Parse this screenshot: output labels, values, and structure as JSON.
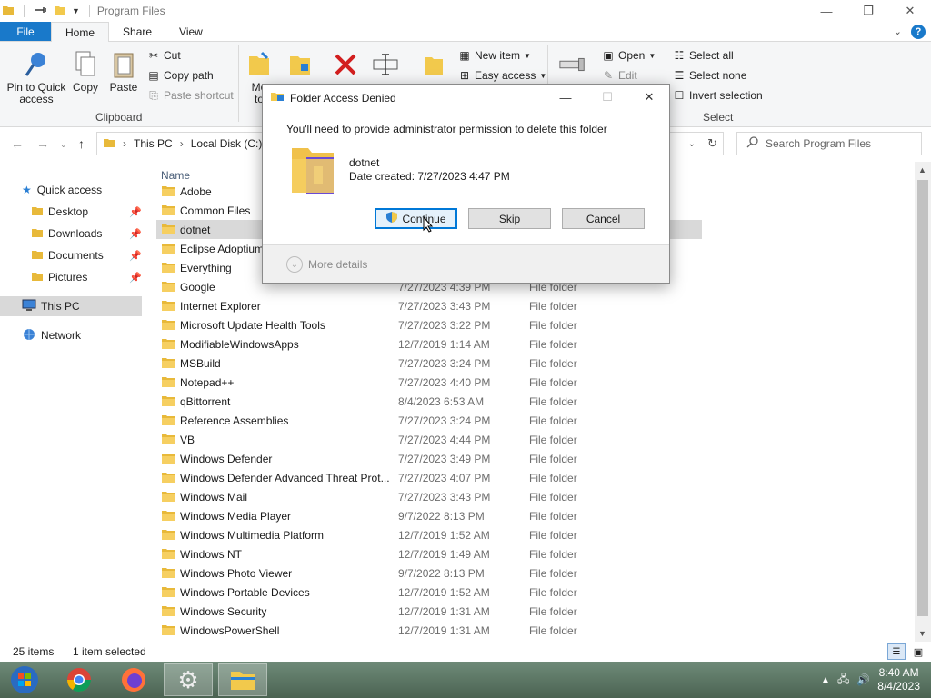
{
  "window": {
    "title": "Program Files",
    "minimize": "—",
    "restore": "❐",
    "close": "✕"
  },
  "tabs": [
    {
      "label": "File"
    },
    {
      "label": "Home"
    },
    {
      "label": "Share"
    },
    {
      "label": "View"
    }
  ],
  "ribbon": {
    "pin_label": "Pin to Quick access",
    "copy_label": "Copy",
    "paste_label": "Paste",
    "cut_label": "Cut",
    "copy_path_label": "Copy path",
    "paste_shortcut_label": "Paste shortcut",
    "clipboard_group": "Clipboard",
    "move_to_label": "Mo to",
    "new_item_label": "New item",
    "easy_access_label": "Easy access",
    "open_label": "Open",
    "edit_label": "Edit",
    "select_all_label": "Select all",
    "select_none_label": "Select none",
    "invert_selection_label": "Invert selection",
    "select_group": "Select"
  },
  "address": {
    "crumbs": [
      "This PC",
      "Local Disk (C:)"
    ],
    "search_placeholder": "Search Program Files"
  },
  "sidebar": {
    "items": [
      {
        "label": "Quick access"
      },
      {
        "label": "Desktop"
      },
      {
        "label": "Downloads"
      },
      {
        "label": "Documents"
      },
      {
        "label": "Pictures"
      },
      {
        "label": "This PC"
      },
      {
        "label": "Network"
      }
    ]
  },
  "filelist": {
    "header_name": "Name",
    "rows": [
      {
        "name": "Adobe",
        "date": "",
        "type": ""
      },
      {
        "name": "Common Files",
        "date": "",
        "type": ""
      },
      {
        "name": "dotnet",
        "date": "",
        "type": ""
      },
      {
        "name": "Eclipse Adoptium",
        "date": "",
        "type": ""
      },
      {
        "name": "Everything",
        "date": "",
        "type": ""
      },
      {
        "name": "Google",
        "date": "7/27/2023 4:39 PM",
        "type": "File folder"
      },
      {
        "name": "Internet Explorer",
        "date": "7/27/2023 3:43 PM",
        "type": "File folder"
      },
      {
        "name": "Microsoft Update Health Tools",
        "date": "7/27/2023 3:22 PM",
        "type": "File folder"
      },
      {
        "name": "ModifiableWindowsApps",
        "date": "12/7/2019 1:14 AM",
        "type": "File folder"
      },
      {
        "name": "MSBuild",
        "date": "7/27/2023 3:24 PM",
        "type": "File folder"
      },
      {
        "name": "Notepad++",
        "date": "7/27/2023 4:40 PM",
        "type": "File folder"
      },
      {
        "name": "qBittorrent",
        "date": "8/4/2023 6:53 AM",
        "type": "File folder"
      },
      {
        "name": "Reference Assemblies",
        "date": "7/27/2023 3:24 PM",
        "type": "File folder"
      },
      {
        "name": "VB",
        "date": "7/27/2023 4:44 PM",
        "type": "File folder"
      },
      {
        "name": "Windows Defender",
        "date": "7/27/2023 3:49 PM",
        "type": "File folder"
      },
      {
        "name": "Windows Defender Advanced Threat Prot...",
        "date": "7/27/2023 4:07 PM",
        "type": "File folder"
      },
      {
        "name": "Windows Mail",
        "date": "7/27/2023 3:43 PM",
        "type": "File folder"
      },
      {
        "name": "Windows Media Player",
        "date": "9/7/2022 8:13 PM",
        "type": "File folder"
      },
      {
        "name": "Windows Multimedia Platform",
        "date": "12/7/2019 1:52 AM",
        "type": "File folder"
      },
      {
        "name": "Windows NT",
        "date": "12/7/2019 1:49 AM",
        "type": "File folder"
      },
      {
        "name": "Windows Photo Viewer",
        "date": "9/7/2022 8:13 PM",
        "type": "File folder"
      },
      {
        "name": "Windows Portable Devices",
        "date": "12/7/2019 1:52 AM",
        "type": "File folder"
      },
      {
        "name": "Windows Security",
        "date": "12/7/2019 1:31 AM",
        "type": "File folder"
      },
      {
        "name": "WindowsPowerShell",
        "date": "12/7/2019 1:31 AM",
        "type": "File folder"
      }
    ]
  },
  "status": {
    "count": "25 items",
    "selected": "1 item selected"
  },
  "taskbar": {
    "time": "8:40 AM",
    "date": "8/4/2023"
  },
  "dialog": {
    "title": "Folder Access Denied",
    "message": "You'll need to provide administrator permission to delete this folder",
    "folder_name": "dotnet",
    "date_created": "Date created: 7/27/2023 4:47 PM",
    "continue_label": "Continue",
    "skip_label": "Skip",
    "cancel_label": "Cancel",
    "more_details_label": "More details"
  },
  "colors": {
    "accent": "#1979ca",
    "selection": "#d9d9d9",
    "focus": "#0078d7"
  }
}
